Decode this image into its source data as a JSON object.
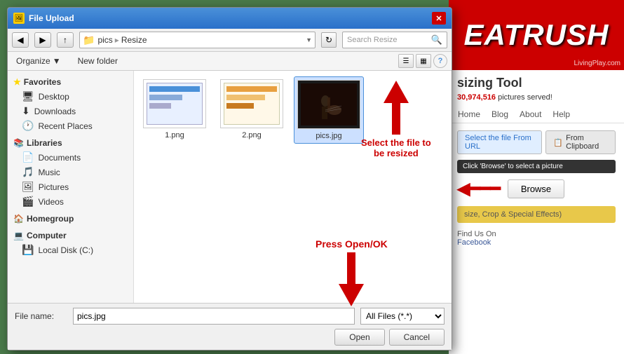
{
  "dialog": {
    "title": "File Upload",
    "address": {
      "path_parts": [
        "pics",
        "Resize"
      ],
      "search_placeholder": "Search Resize"
    },
    "toolbar": {
      "organize": "Organize",
      "new_folder": "New folder"
    },
    "sidebar": {
      "favorites_label": "Favorites",
      "desktop_label": "Desktop",
      "downloads_label": "Downloads",
      "recent_places_label": "Recent Places",
      "libraries_label": "Libraries",
      "documents_label": "Documents",
      "music_label": "Music",
      "pictures_label": "Pictures",
      "videos_label": "Videos",
      "homegroup_label": "Homegroup",
      "computer_label": "Computer",
      "local_disk_label": "Local Disk (C:)"
    },
    "files": [
      {
        "name": "1.png",
        "type": "document"
      },
      {
        "name": "2.png",
        "type": "document_yellow"
      },
      {
        "name": "pics.jpg",
        "type": "photo",
        "selected": true
      }
    ],
    "bottom": {
      "filename_label": "File name:",
      "filename_value": "pics.jpg",
      "filetype_value": "All Files (*.*)",
      "open_btn": "Open",
      "cancel_btn": "Cancel"
    }
  },
  "annotations": {
    "select_text_line1": "Select the file to",
    "select_text_line2": "be resized",
    "press_text": "Press Open/OK"
  },
  "website": {
    "header_text": "EATRUSH",
    "living_play": "LivingPlay.com",
    "subtitle": "sizing Tool",
    "counter_value": "30,974,516",
    "counter_suffix": "pictures served!",
    "nav": {
      "home": "Home",
      "blog": "Blog",
      "about": "About",
      "help": "Help"
    },
    "from_url_label": "Select the file From URL",
    "from_clipboard_label": "From Clipboard",
    "tooltip": "Click 'Browse' to select a picture",
    "browse_btn": "Browse",
    "effects_label": "size, Crop & Special Effects)",
    "find_us": "Find Us On",
    "facebook": "Facebook"
  }
}
